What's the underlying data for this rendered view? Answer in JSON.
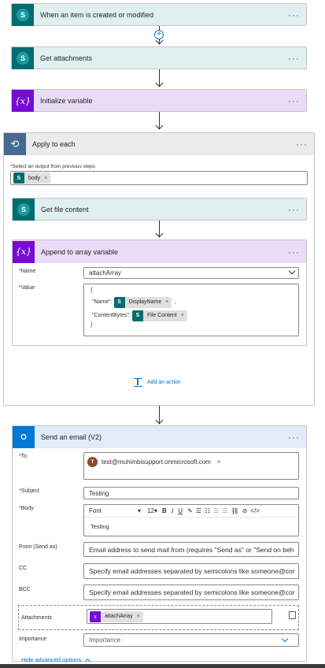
{
  "steps": {
    "trigger": {
      "title": "When an item is created or modified",
      "icon": "sharepoint-icon"
    },
    "get_attachments": {
      "title": "Get attachments",
      "icon": "sharepoint-icon"
    },
    "init_var": {
      "title": "Initialize variable",
      "icon": "variable-icon"
    },
    "apply_each": {
      "title": "Apply to each",
      "select_label": "Select an output from previous steps",
      "body_token": "body",
      "get_file": {
        "title": "Get file content"
      },
      "append": {
        "title": "Append to array variable",
        "name_label": "Name",
        "name_value": "attachArray",
        "value_label": "Value",
        "value_open": "{",
        "value_name_key": "\"Name\":",
        "value_name_token": "DisplayName",
        "value_comma": ",",
        "value_content_key": "\"ContentBytes\":",
        "value_content_token": "File Content",
        "value_close": "}"
      },
      "add_action": "Add an action"
    },
    "send_email": {
      "title": "Send an email (V2)",
      "to_label": "To",
      "to_avatar": "T",
      "to_value": "test@muhimbisupport.onmicrosoft.com",
      "subject_label": "Subject",
      "subject_value": "Testing",
      "body_label": "Body",
      "body_font": "Font",
      "body_size": "12",
      "body_value": "Testing",
      "from_label": "From (Send as)",
      "from_placeholder": "Email address to send mail from (requires \"Send as\" or \"Send on beh",
      "cc_label": "CC",
      "cc_placeholder": "Specify email addresses separated by semicolons like someone@cor",
      "bcc_label": "BCC",
      "bcc_placeholder": "Specify email addresses separated by semicolons like someone@cor",
      "attach_label": "Attachments",
      "attach_token": "attachArray",
      "importance_label": "Importance",
      "importance_value": "Importance",
      "hide_advanced": "Hide advanced options"
    }
  },
  "required_mark": "*",
  "more_glyph": "···",
  "remove_glyph": "×",
  "colors": {
    "sharepoint": "#036c70",
    "variable": "#770bd6",
    "outlook": "#0078d4",
    "link": "#0078d4"
  }
}
